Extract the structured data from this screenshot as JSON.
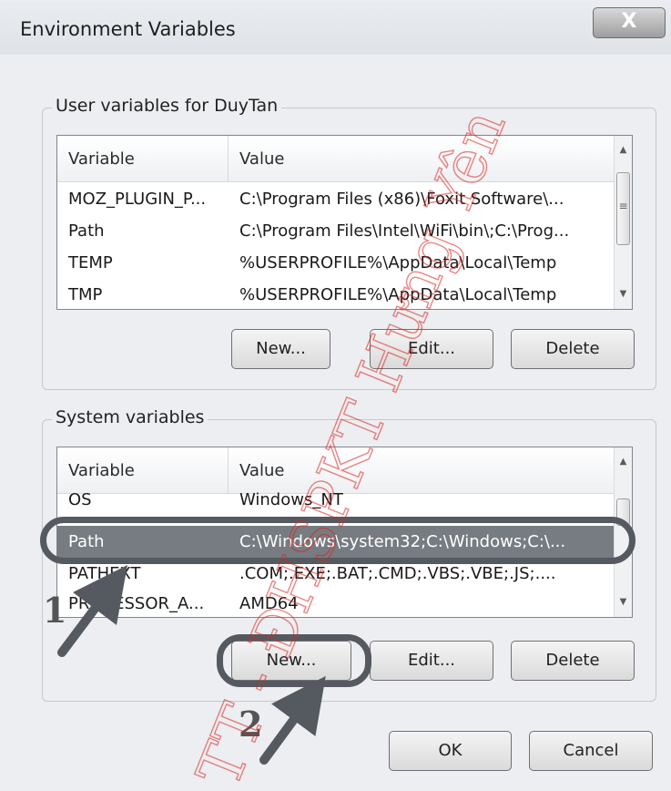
{
  "window": {
    "title": "Environment Variables",
    "close_symbol": "X"
  },
  "user_group": {
    "label": "User variables for DuyTan",
    "columns": [
      "Variable",
      "Value"
    ],
    "rows": [
      {
        "variable": "MOZ_PLUGIN_P...",
        "value": "C:\\Program Files (x86)\\Foxit Software\\..."
      },
      {
        "variable": "Path",
        "value": "C:\\Program Files\\Intel\\WiFi\\bin\\;C:\\Prog..."
      },
      {
        "variable": "TEMP",
        "value": "%USERPROFILE%\\AppData\\Local\\Temp"
      },
      {
        "variable": "TMP",
        "value": "%USERPROFILE%\\AppData\\Local\\Temp"
      }
    ],
    "buttons": {
      "new": "New...",
      "edit": "Edit...",
      "delete": "Delete"
    }
  },
  "system_group": {
    "label": "System variables",
    "columns": [
      "Variable",
      "Value"
    ],
    "rows": [
      {
        "variable": "OS",
        "value": "Windows_NT"
      },
      {
        "variable": "Path",
        "value": "C:\\Windows\\system32;C:\\Windows;C:\\...",
        "selected": true
      },
      {
        "variable": "PATHEXT",
        "value": ".COM;.EXE;.BAT;.CMD;.VBS;.VBE;.JS;...."
      },
      {
        "variable": "PROCESSOR_A...",
        "value": "AMD64"
      }
    ],
    "buttons": {
      "new": "New...",
      "edit": "Edit...",
      "delete": "Delete"
    }
  },
  "footer": {
    "ok": "OK",
    "cancel": "Cancel"
  },
  "annotations": {
    "step1": "1",
    "step2": "2",
    "watermark": "TT - ĐHSPKT Hưng Yên",
    "callout_color": "#555a60",
    "watermark_color": "#d9231f"
  }
}
